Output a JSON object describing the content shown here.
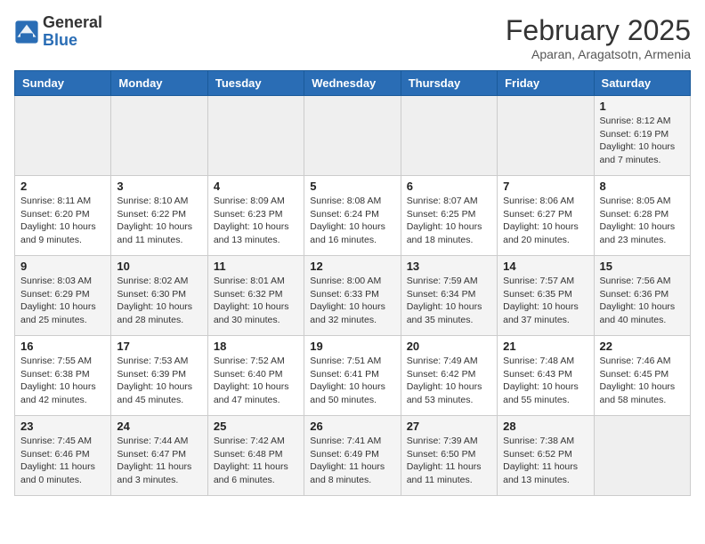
{
  "header": {
    "logo_line1": "General",
    "logo_line2": "Blue",
    "month_title": "February 2025",
    "location": "Aparan, Aragatsotn, Armenia"
  },
  "days_of_week": [
    "Sunday",
    "Monday",
    "Tuesday",
    "Wednesday",
    "Thursday",
    "Friday",
    "Saturday"
  ],
  "weeks": [
    [
      {
        "day": "",
        "info": ""
      },
      {
        "day": "",
        "info": ""
      },
      {
        "day": "",
        "info": ""
      },
      {
        "day": "",
        "info": ""
      },
      {
        "day": "",
        "info": ""
      },
      {
        "day": "",
        "info": ""
      },
      {
        "day": "1",
        "info": "Sunrise: 8:12 AM\nSunset: 6:19 PM\nDaylight: 10 hours\nand 7 minutes."
      }
    ],
    [
      {
        "day": "2",
        "info": "Sunrise: 8:11 AM\nSunset: 6:20 PM\nDaylight: 10 hours\nand 9 minutes."
      },
      {
        "day": "3",
        "info": "Sunrise: 8:10 AM\nSunset: 6:22 PM\nDaylight: 10 hours\nand 11 minutes."
      },
      {
        "day": "4",
        "info": "Sunrise: 8:09 AM\nSunset: 6:23 PM\nDaylight: 10 hours\nand 13 minutes."
      },
      {
        "day": "5",
        "info": "Sunrise: 8:08 AM\nSunset: 6:24 PM\nDaylight: 10 hours\nand 16 minutes."
      },
      {
        "day": "6",
        "info": "Sunrise: 8:07 AM\nSunset: 6:25 PM\nDaylight: 10 hours\nand 18 minutes."
      },
      {
        "day": "7",
        "info": "Sunrise: 8:06 AM\nSunset: 6:27 PM\nDaylight: 10 hours\nand 20 minutes."
      },
      {
        "day": "8",
        "info": "Sunrise: 8:05 AM\nSunset: 6:28 PM\nDaylight: 10 hours\nand 23 minutes."
      }
    ],
    [
      {
        "day": "9",
        "info": "Sunrise: 8:03 AM\nSunset: 6:29 PM\nDaylight: 10 hours\nand 25 minutes."
      },
      {
        "day": "10",
        "info": "Sunrise: 8:02 AM\nSunset: 6:30 PM\nDaylight: 10 hours\nand 28 minutes."
      },
      {
        "day": "11",
        "info": "Sunrise: 8:01 AM\nSunset: 6:32 PM\nDaylight: 10 hours\nand 30 minutes."
      },
      {
        "day": "12",
        "info": "Sunrise: 8:00 AM\nSunset: 6:33 PM\nDaylight: 10 hours\nand 32 minutes."
      },
      {
        "day": "13",
        "info": "Sunrise: 7:59 AM\nSunset: 6:34 PM\nDaylight: 10 hours\nand 35 minutes."
      },
      {
        "day": "14",
        "info": "Sunrise: 7:57 AM\nSunset: 6:35 PM\nDaylight: 10 hours\nand 37 minutes."
      },
      {
        "day": "15",
        "info": "Sunrise: 7:56 AM\nSunset: 6:36 PM\nDaylight: 10 hours\nand 40 minutes."
      }
    ],
    [
      {
        "day": "16",
        "info": "Sunrise: 7:55 AM\nSunset: 6:38 PM\nDaylight: 10 hours\nand 42 minutes."
      },
      {
        "day": "17",
        "info": "Sunrise: 7:53 AM\nSunset: 6:39 PM\nDaylight: 10 hours\nand 45 minutes."
      },
      {
        "day": "18",
        "info": "Sunrise: 7:52 AM\nSunset: 6:40 PM\nDaylight: 10 hours\nand 47 minutes."
      },
      {
        "day": "19",
        "info": "Sunrise: 7:51 AM\nSunset: 6:41 PM\nDaylight: 10 hours\nand 50 minutes."
      },
      {
        "day": "20",
        "info": "Sunrise: 7:49 AM\nSunset: 6:42 PM\nDaylight: 10 hours\nand 53 minutes."
      },
      {
        "day": "21",
        "info": "Sunrise: 7:48 AM\nSunset: 6:43 PM\nDaylight: 10 hours\nand 55 minutes."
      },
      {
        "day": "22",
        "info": "Sunrise: 7:46 AM\nSunset: 6:45 PM\nDaylight: 10 hours\nand 58 minutes."
      }
    ],
    [
      {
        "day": "23",
        "info": "Sunrise: 7:45 AM\nSunset: 6:46 PM\nDaylight: 11 hours\nand 0 minutes."
      },
      {
        "day": "24",
        "info": "Sunrise: 7:44 AM\nSunset: 6:47 PM\nDaylight: 11 hours\nand 3 minutes."
      },
      {
        "day": "25",
        "info": "Sunrise: 7:42 AM\nSunset: 6:48 PM\nDaylight: 11 hours\nand 6 minutes."
      },
      {
        "day": "26",
        "info": "Sunrise: 7:41 AM\nSunset: 6:49 PM\nDaylight: 11 hours\nand 8 minutes."
      },
      {
        "day": "27",
        "info": "Sunrise: 7:39 AM\nSunset: 6:50 PM\nDaylight: 11 hours\nand 11 minutes."
      },
      {
        "day": "28",
        "info": "Sunrise: 7:38 AM\nSunset: 6:52 PM\nDaylight: 11 hours\nand 13 minutes."
      },
      {
        "day": "",
        "info": ""
      }
    ]
  ]
}
